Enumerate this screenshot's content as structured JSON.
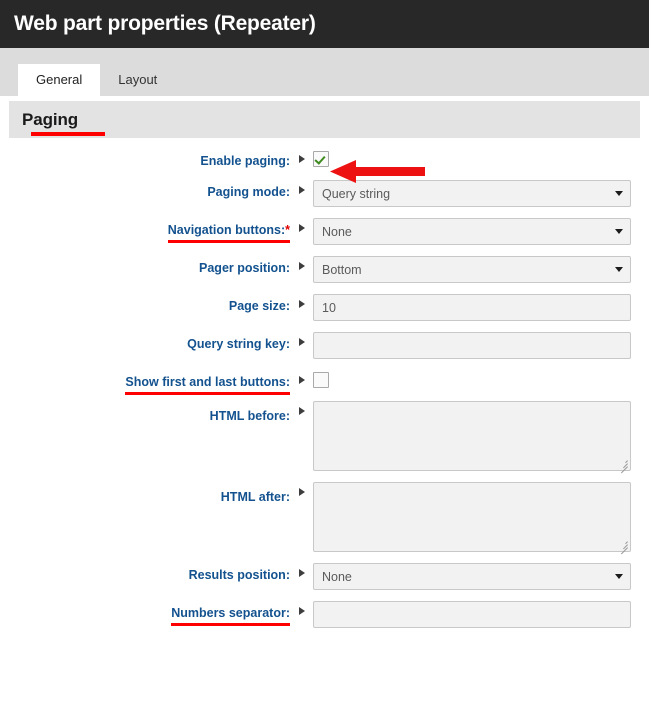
{
  "window": {
    "title": "Web part properties (Repeater)"
  },
  "tabs": [
    {
      "label": "General",
      "active": true
    },
    {
      "label": "Layout",
      "active": false
    }
  ],
  "section": {
    "title": "Paging",
    "underline_color": "#fe0000"
  },
  "annotations": {
    "arrow_color": "#ee1111",
    "underline_color": "#fe0000"
  },
  "colors": {
    "titlebar_bg": "#282828",
    "tabstrip_bg": "#dcdcdc",
    "section_bg": "#e3e3e3",
    "label_color": "#13528f",
    "field_bg": "#f2f2f2",
    "field_border": "#c8c8c8",
    "required_asterisk": "#e00000",
    "check_color": "#3f8b20"
  },
  "fields": [
    {
      "label": "Enable paging:",
      "type": "checkbox",
      "checked": true,
      "required": false,
      "underlined": false,
      "marker": "expand-triangle-icon"
    },
    {
      "label": "Paging mode:",
      "type": "select",
      "value": "Query string",
      "required": false,
      "underlined": false,
      "marker": "expand-triangle-icon"
    },
    {
      "label": "Navigation buttons:",
      "type": "select",
      "value": "None",
      "required": true,
      "underlined": true,
      "marker": "expand-triangle-icon"
    },
    {
      "label": "Pager position:",
      "type": "select",
      "value": "Bottom",
      "required": false,
      "underlined": false,
      "marker": "expand-triangle-icon"
    },
    {
      "label": "Page size:",
      "type": "text",
      "value": "10",
      "required": false,
      "underlined": false,
      "marker": "expand-triangle-icon"
    },
    {
      "label": "Query string key:",
      "type": "text",
      "value": "",
      "required": false,
      "underlined": false,
      "marker": "expand-triangle-icon"
    },
    {
      "label": "Show first and last buttons:",
      "type": "checkbox",
      "checked": false,
      "required": false,
      "underlined": true,
      "marker": "expand-triangle-icon"
    },
    {
      "label": "HTML before:",
      "type": "textarea",
      "value": "",
      "required": false,
      "underlined": false,
      "marker": "expand-triangle-icon"
    },
    {
      "label": "HTML after:",
      "type": "textarea",
      "value": "",
      "required": false,
      "underlined": false,
      "marker": "expand-triangle-icon"
    },
    {
      "label": "Results position:",
      "type": "select",
      "value": "None",
      "required": false,
      "underlined": false,
      "marker": "expand-triangle-icon"
    },
    {
      "label": "Numbers separator:",
      "type": "text",
      "value": "",
      "required": false,
      "underlined": true,
      "marker": "expand-triangle-icon"
    }
  ]
}
